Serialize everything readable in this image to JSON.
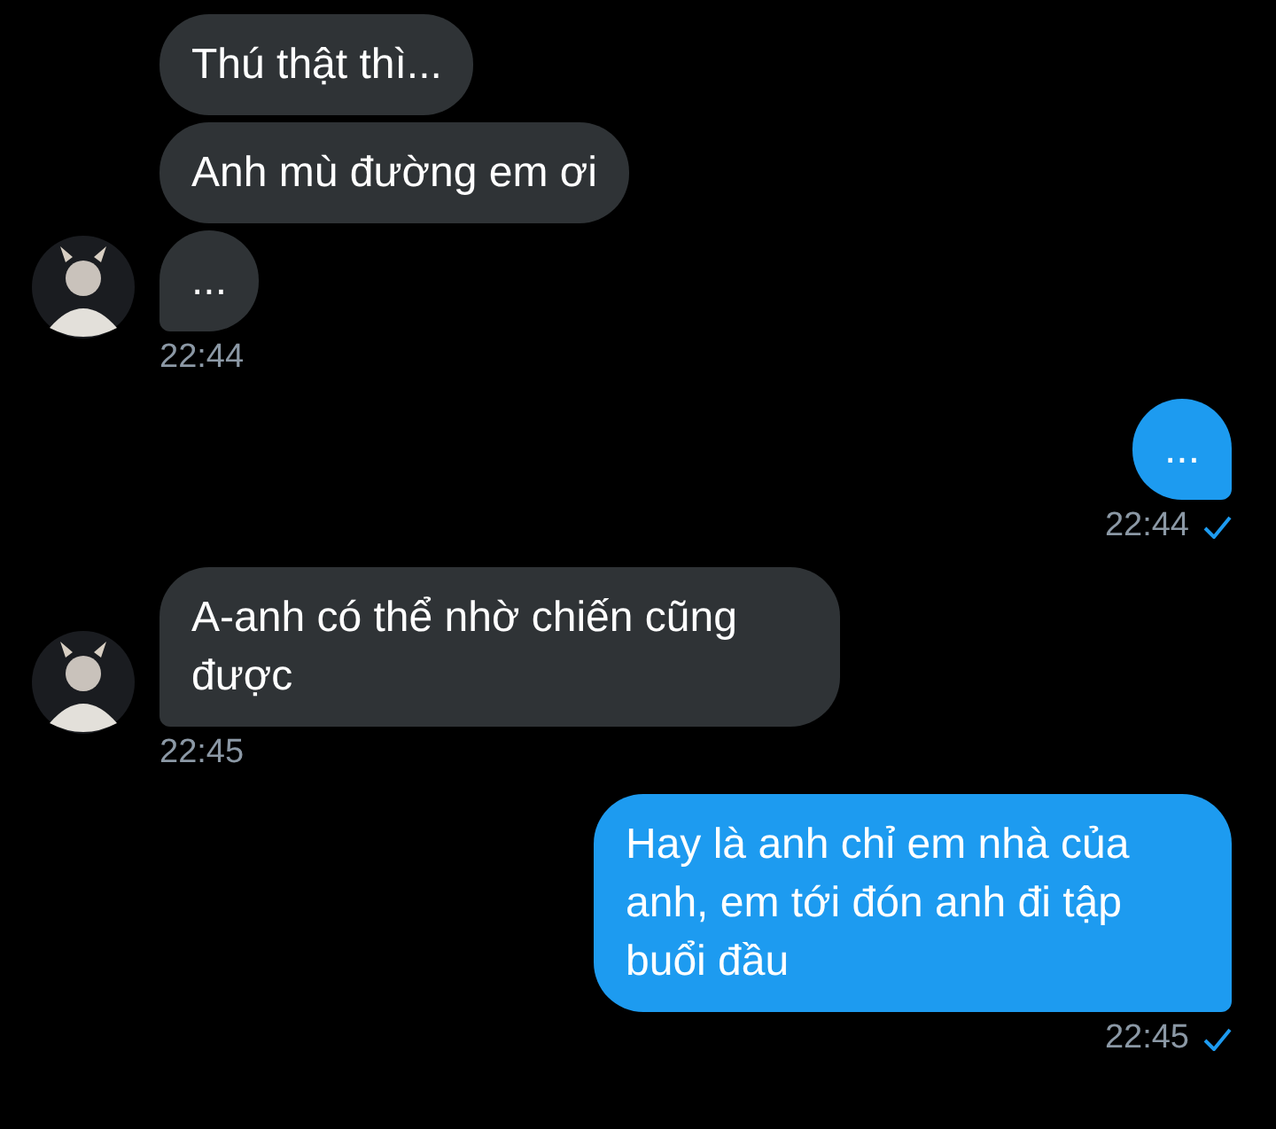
{
  "messages": [
    {
      "kind": "incoming",
      "bubbles": [
        "Thú thật thì...",
        "Anh mù đường em ơi",
        "..."
      ],
      "time": "22:44"
    },
    {
      "kind": "outgoing",
      "bubbles": [
        "..."
      ],
      "time": "22:44",
      "read": true
    },
    {
      "kind": "incoming",
      "bubbles": [
        "A-anh có thể nhờ chiến cũng được"
      ],
      "time": "22:45"
    },
    {
      "kind": "outgoing",
      "bubbles": [
        "Hay là anh chỉ em nhà của anh, em tới đón anh đi tập buổi đầu"
      ],
      "time": "22:45",
      "read": true
    }
  ]
}
